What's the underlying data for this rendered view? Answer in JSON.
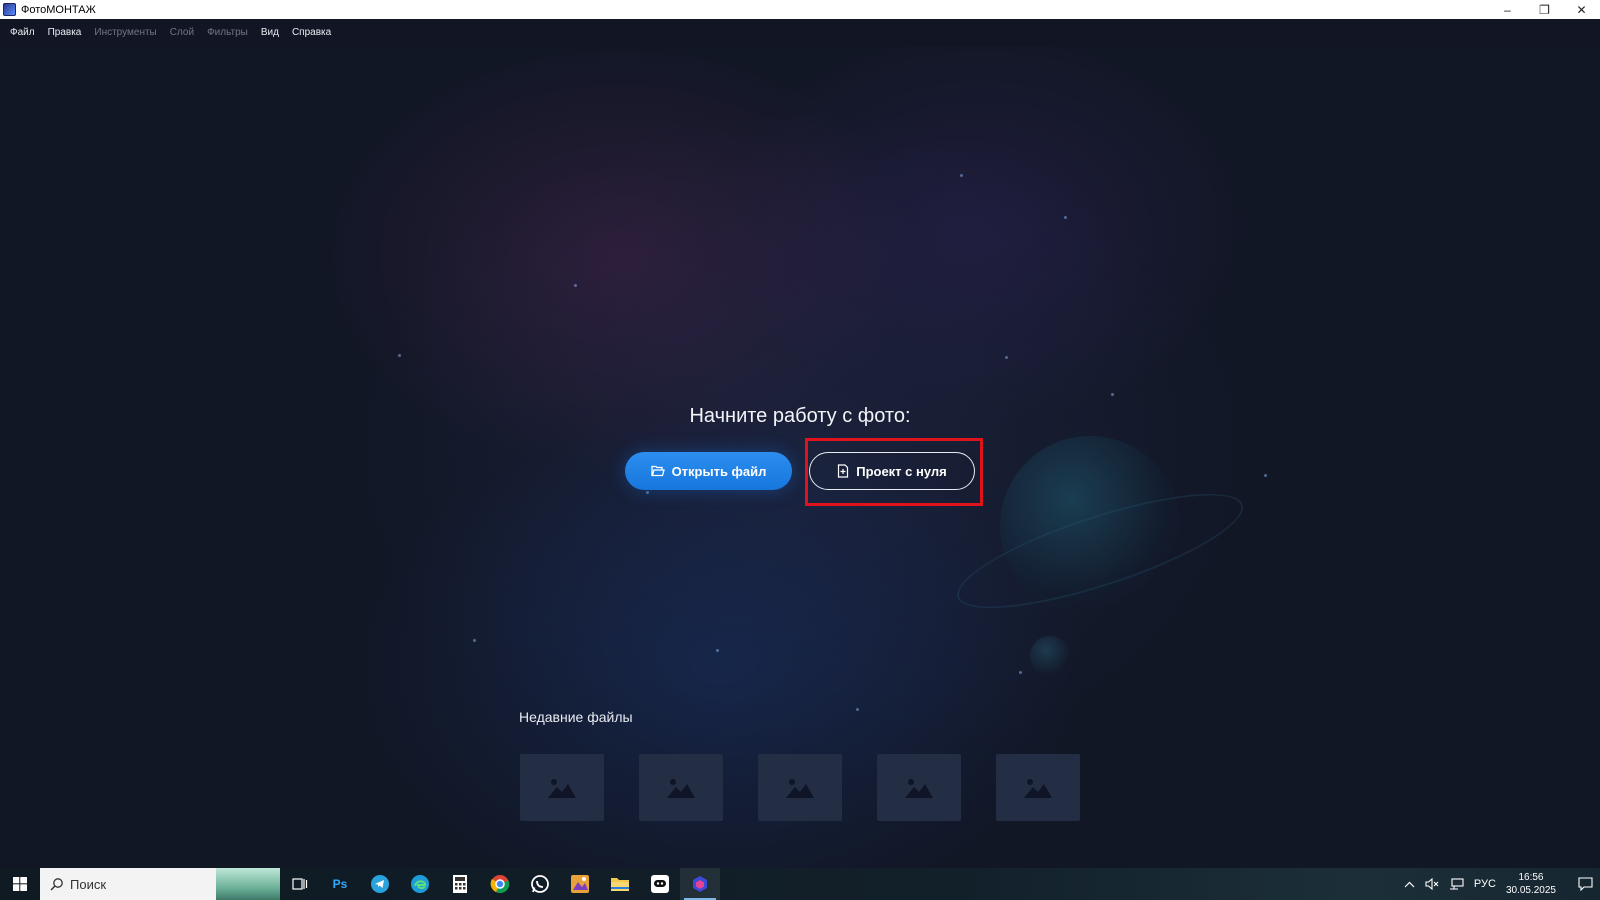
{
  "window": {
    "title": "ФотоМОНТАЖ",
    "controls": {
      "minimize": "–",
      "restore": "❐",
      "close": "✕"
    }
  },
  "menu": [
    {
      "label": "Файл",
      "enabled": true
    },
    {
      "label": "Правка",
      "enabled": true
    },
    {
      "label": "Инструменты",
      "enabled": false
    },
    {
      "label": "Слой",
      "enabled": false
    },
    {
      "label": "Фильтры",
      "enabled": false
    },
    {
      "label": "Вид",
      "enabled": true
    },
    {
      "label": "Справка",
      "enabled": true
    }
  ],
  "start": {
    "title": "Начните работу с фото:",
    "open_file_label": "Открыть файл",
    "new_project_label": "Проект с нуля"
  },
  "recent": {
    "title": "Недавние файлы",
    "items": [
      "image-placeholder",
      "image-placeholder",
      "image-placeholder",
      "image-placeholder",
      "image-placeholder"
    ]
  },
  "taskbar": {
    "search_placeholder": "Поиск",
    "apps": [
      "task-view",
      "photoshop",
      "telegram",
      "edge",
      "calculator",
      "chrome",
      "whatsapp",
      "photo-editor",
      "file-explorer",
      "messenger",
      "fotomontazh"
    ],
    "photoshop_label": "Ps",
    "language": "РУС",
    "time": "16:56",
    "date": "30.05.2025"
  },
  "colors": {
    "accent_blue": "#1e80e6",
    "highlight_red": "#e0121b",
    "background": "#121726"
  }
}
